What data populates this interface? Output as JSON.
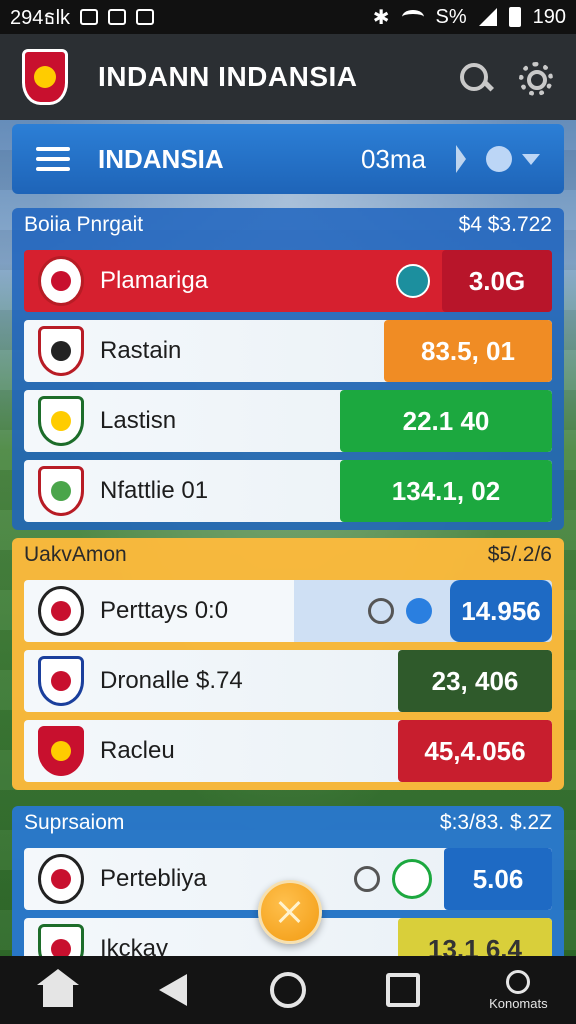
{
  "status_bar": {
    "left_text": "294ธlk",
    "time": "190",
    "charge_text": "S%"
  },
  "app_bar": {
    "title": "INDANN INDANSIA"
  },
  "selector": {
    "name": "INDANSIA",
    "meta": "03ma"
  },
  "groups": [
    {
      "title": "Boiia Pnrgait",
      "total": "$4 $3.722",
      "rows": [
        {
          "name": "Plamariga",
          "value": "3.0G",
          "color": "#c0182a"
        },
        {
          "name": "Rastain",
          "value": "83.5, 01",
          "color": "#f08c24"
        },
        {
          "name": "Lastisn",
          "value": "22.1  40",
          "color": "#1ca83f"
        },
        {
          "name": "Nfattlie 01",
          "value": "134.1, 02",
          "color": "#1ca83f"
        }
      ]
    },
    {
      "title": "UakvAmon",
      "total": "$5/.2/6",
      "rows": [
        {
          "name": "Perttays 0:0",
          "value": "14.956",
          "color": "#1e6ac4"
        },
        {
          "name": "Dronalle $.74",
          "value": "23, 406",
          "color": "#2f5a2b"
        },
        {
          "name": "Racleu",
          "value": "45,4.056",
          "color": "#c81e2e"
        }
      ]
    },
    {
      "title": "Suprsaiom",
      "total": "$:3/83. $.2Z",
      "rows": [
        {
          "name": "Pertebliya",
          "value": "5.06",
          "color": "#1e6ac4"
        },
        {
          "name": "Ikckay",
          "value": "13.1    6.4",
          "color": "#d9cf3a"
        }
      ]
    }
  ],
  "nav": {
    "profile_label": "Konomats"
  },
  "icons": [
    "search-icon",
    "gear-icon",
    "menu-icon",
    "home-icon",
    "back-icon",
    "circle-icon",
    "square-icon",
    "profile-icon",
    "close-icon"
  ]
}
